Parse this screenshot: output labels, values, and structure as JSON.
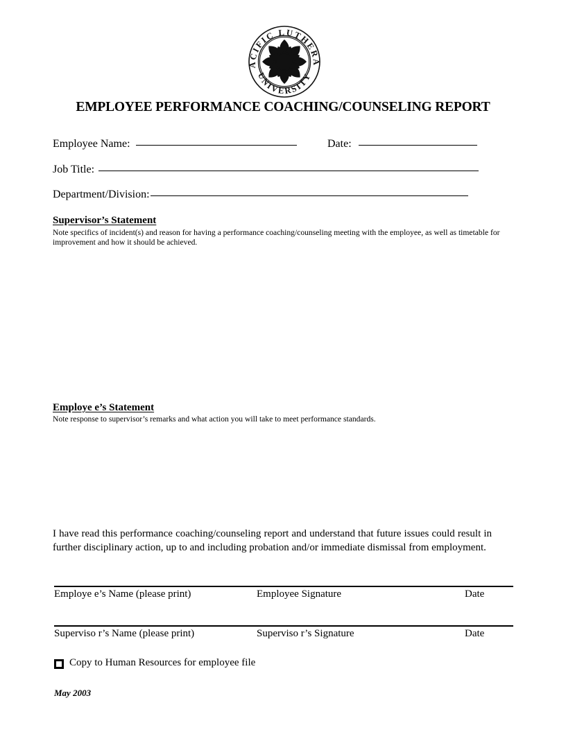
{
  "logo": {
    "name": "pacific-lutheran-university-seal",
    "top_arc_text": "PACIFIC LUTHERAN",
    "bottom_arc_text": "UNIVERSITY"
  },
  "title": "EMPLOYEE PERFORMANCE COACHING/COUNSELING REPORT",
  "fields": {
    "employee_name_label": "Employee Name:",
    "employee_name_value": "",
    "date_label": "Date:",
    "date_value": "",
    "job_title_label": "Job Title:",
    "job_title_value": "",
    "department_label": "Department/Division:",
    "department_value": ""
  },
  "supervisor_section": {
    "heading": "Supervisor’s Statement",
    "note": "Note specifics of incident(s) and reason for having a performance coaching/counseling meeting with the employee, as well as timetable for improvement and how it should be achieved.",
    "body_value": ""
  },
  "employee_section": {
    "heading": "Employe e’s Statement",
    "note": "Note response to supervisor’s remarks and what action you will take to meet performance standards.",
    "body_value": ""
  },
  "acknowledgment": "I have read this performance coaching/counseling report and understand that future issues could result in further disciplinary action, up to and including probation and/or immediate dismissal from employment.",
  "signatures": [
    {
      "name_label": "Employe e’s Name (please print)",
      "signature_label": "Employee Signature",
      "date_label": "Date"
    },
    {
      "name_label": "Superviso r’s Name (please print)",
      "signature_label": "Superviso  r’s Signature",
      "date_label": "Date"
    }
  ],
  "copy_line": {
    "checkbox_checked": false,
    "label": "Copy to Human Resources for employee file"
  },
  "footer_date": "May 2003"
}
